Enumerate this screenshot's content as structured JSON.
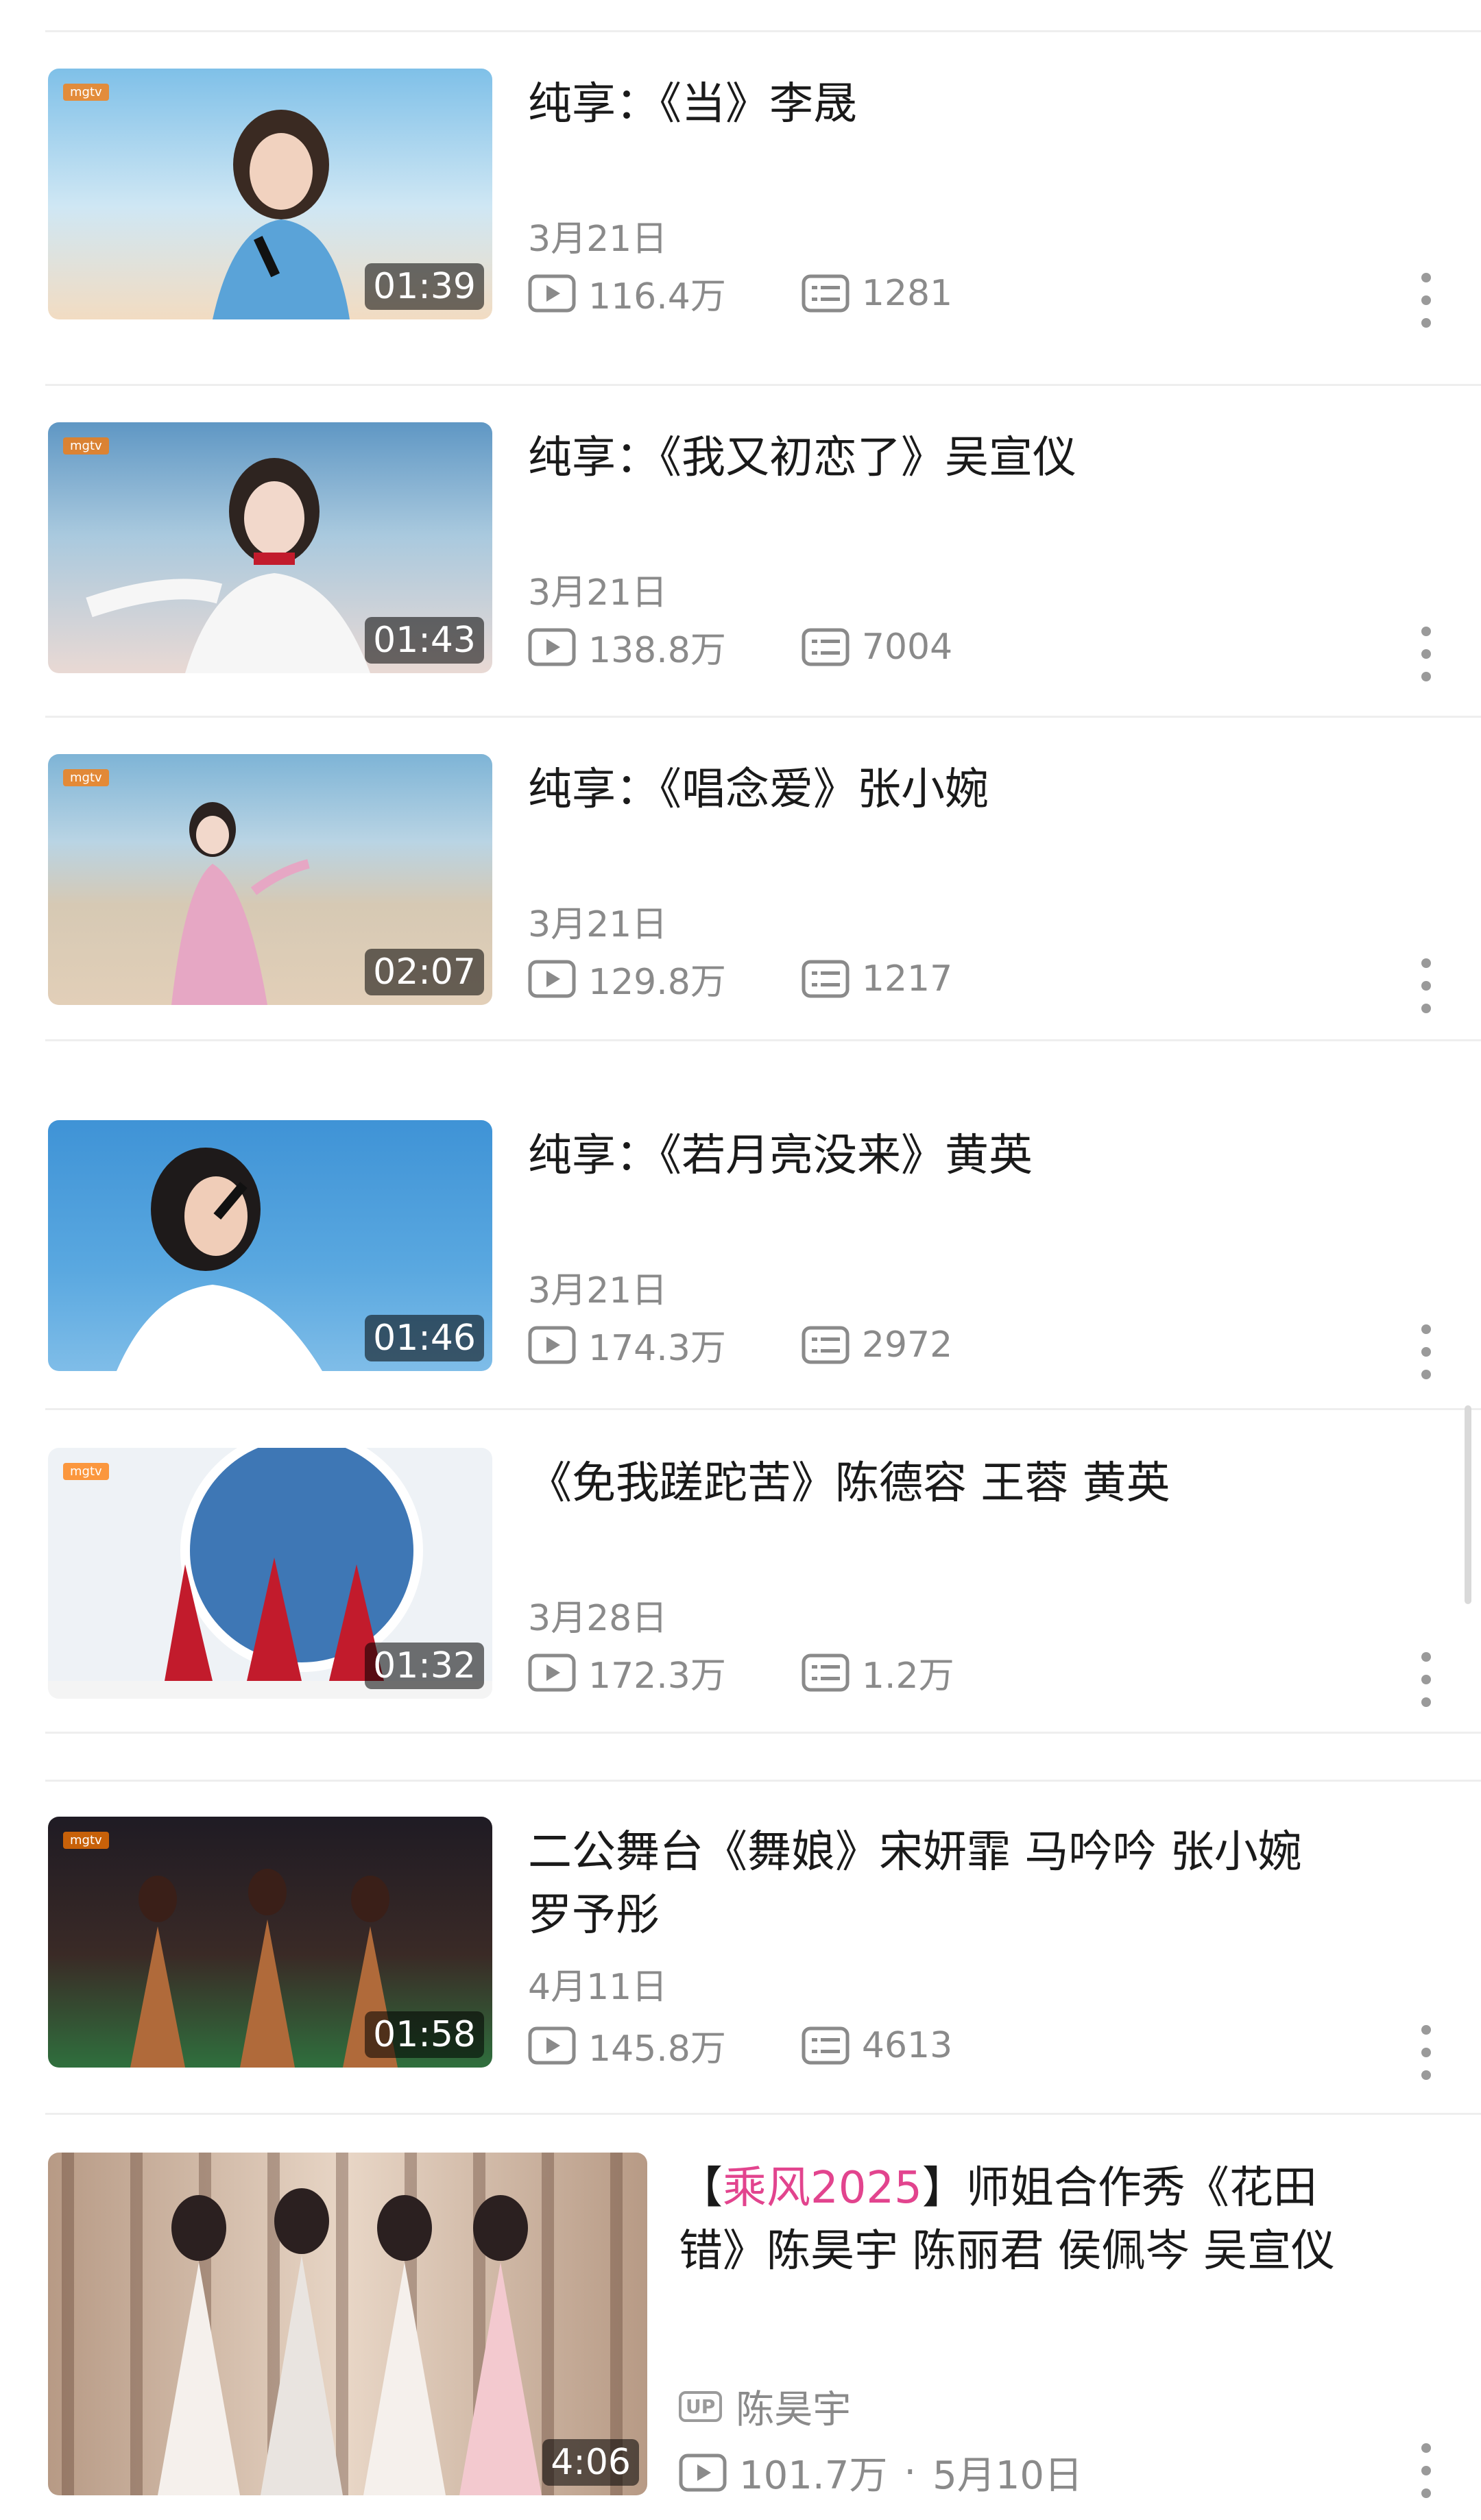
{
  "videos": [
    {
      "title": "纯享：《当》李晟",
      "date": "3月21日",
      "views": "116.4万",
      "comments": "1281",
      "duration": "01:39",
      "thumb_colors": [
        "#8ec8ea",
        "#cfe7f4",
        "#f2dcc2"
      ]
    },
    {
      "title": "纯享：《我又初恋了》吴宣仪",
      "date": "3月21日",
      "views": "138.8万",
      "comments": "7004",
      "duration": "01:43",
      "thumb_colors": [
        "#6fa5cc",
        "#c5dbe8",
        "#e9d9d4"
      ]
    },
    {
      "title": "纯享：《唱念爱》张小婉",
      "date": "3月21日",
      "views": "129.8万",
      "comments": "1217",
      "duration": "02:07",
      "thumb_colors": [
        "#7eb4d6",
        "#d6c9b4",
        "#e6c6c6"
      ]
    },
    {
      "title": "纯享：《若月亮没来》黄英",
      "date": "3月21日",
      "views": "174.3万",
      "comments": "2972",
      "duration": "01:46",
      "thumb_colors": [
        "#3f93d6",
        "#7fbde8",
        "#ffffff"
      ]
    },
    {
      "title": "《免我蹉跎苦》陈德容 王蓉 黄英",
      "date": "3月28日",
      "views": "172.3万",
      "comments": "1.2万",
      "duration": "01:32",
      "thumb_colors": [
        "#eaf0f6",
        "#3e77b5",
        "#c21b2c"
      ]
    },
    {
      "title_line1": "二公舞台《舞娘》宋妍霏 马吟吟 张小婉",
      "title_line2": "罗予彤",
      "date": "4月11日",
      "views": "145.8万",
      "comments": "4613",
      "duration": "01:58",
      "thumb_colors": [
        "#1f1b24",
        "#b06a3a",
        "#2f6f3d"
      ]
    }
  ],
  "promo": {
    "bracket_open": "【",
    "highlight": "乘风2025",
    "bracket_close": "】",
    "title_rest_line1": "师姐合作秀《花田",
    "title_line2": "错》陈昊宇 陈丽君 侯佩岑 吴宣仪",
    "up_badge": "UP",
    "uploader": "陈昊宇",
    "views": "101.7万",
    "separator": "·",
    "date": "5月10日",
    "duration": "4:06",
    "highlight_color": "#e2448e"
  }
}
